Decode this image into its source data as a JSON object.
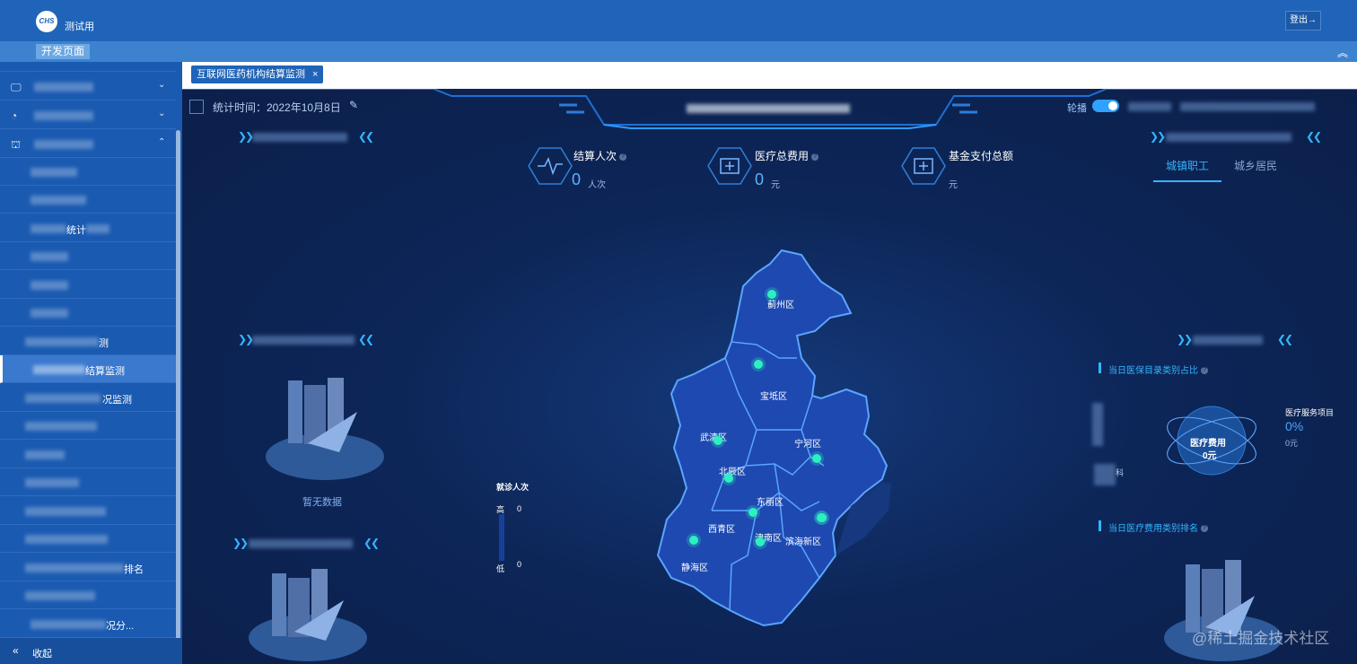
{
  "topbar": {
    "logo_text": "CHS",
    "title": "测试用",
    "logout_label": "登出→",
    "dev_tag": "开发页面"
  },
  "sidebar": {
    "items": [
      {
        "label": "",
        "icon": "monitor-icon",
        "has_chevron": true
      },
      {
        "label": "",
        "icon": "dashboard-icon",
        "has_chevron": true
      },
      {
        "label": "",
        "icon": "chart-board-icon",
        "has_chevron": true,
        "expanded": true
      },
      {
        "label": ""
      },
      {
        "label": ""
      },
      {
        "label": "统计"
      },
      {
        "label": ""
      },
      {
        "label": ""
      },
      {
        "label": ""
      },
      {
        "label": "测"
      },
      {
        "label": "结算监测",
        "active": true
      },
      {
        "label": "况监测"
      },
      {
        "label": ""
      },
      {
        "label": ""
      },
      {
        "label": ""
      },
      {
        "label": ""
      },
      {
        "label": ""
      },
      {
        "label": "排名"
      },
      {
        "label": ""
      },
      {
        "label": "况分..."
      }
    ],
    "collapse_label": "收起"
  },
  "tab": {
    "label": "互联网医药机构结算监测",
    "close": "×"
  },
  "dashboard": {
    "stat_time": "统计时间：2022年10月8日",
    "carousel_label": "轮播",
    "kpis": [
      {
        "title": "结算人次",
        "value": "0",
        "unit": "人次",
        "icon": "heartbeat-icon"
      },
      {
        "title": "医疗总费用",
        "value": "0",
        "unit": "元",
        "icon": "medical-kit-icon"
      },
      {
        "title": "基金支付总额",
        "value": "",
        "unit": "元",
        "icon": "medical-kit-icon"
      }
    ],
    "insurance_tabs": [
      "城镇职工",
      "城乡居民"
    ],
    "left_no_data": "暂无数据",
    "legend": {
      "title": "就诊人次",
      "high_label": "高",
      "low_label": "低",
      "high_value": "0",
      "low_value": "0"
    },
    "districts": [
      "蓟州区",
      "宝坻区",
      "武清区",
      "宁河区",
      "北辰区",
      "东丽区",
      "西青区",
      "津南区",
      "滨海新区",
      "静海区"
    ],
    "right": {
      "catalog_title": "当日医保目录类别占比",
      "ring_title": "医疗费用",
      "ring_value": "0元",
      "service_title": "医疗服务项目",
      "service_pct": "0%",
      "service_amount": "0元",
      "partial_label": "科",
      "ranking_title": "当日医疗费用类别排名"
    },
    "watermark": "@稀土掘金技术社区"
  },
  "colors": {
    "header": "#1f64b8",
    "sidebar": "#1a5ab1",
    "dashboard_bg": "#0b1f4a",
    "map_fill": "#1e49b0",
    "accent": "#34b6ff"
  }
}
